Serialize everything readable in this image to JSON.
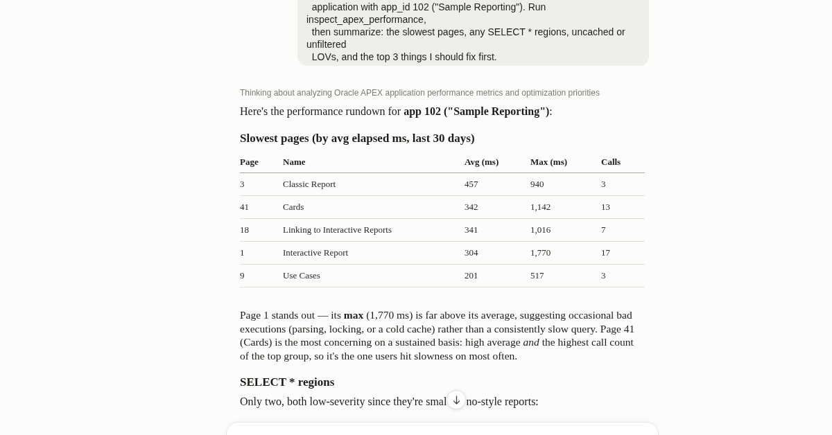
{
  "user_message": {
    "lines": [
      "  application with app_id 102 (\"Sample Reporting\"). Run",
      "inspect_apex_performance,",
      "  then summarize: the slowest pages, any SELECT * regions, uncached or",
      "unfiltered",
      "  LOVs, and the top 3 things I should fix first."
    ]
  },
  "thinking": {
    "label": "Thinking about analyzing Oracle APEX application performance metrics and optimization priorities"
  },
  "response": {
    "intro": "Here's the performance rundown for **app 102 (\"Sample Reporting\")**:",
    "slowest_pages": {
      "heading": "Slowest pages (by avg elapsed ms, last 30 days)",
      "table": {
        "columns": [
          "Page",
          "Name",
          "Avg (ms)",
          "Max (ms)",
          "Calls"
        ],
        "rows": [
          [
            "3",
            "Classic Report",
            "457",
            "940",
            "3"
          ],
          [
            "41",
            "Cards",
            "342",
            "1,142",
            "13"
          ],
          [
            "18",
            "Linking to Interactive Reports",
            "341",
            "1,016",
            "7"
          ],
          [
            "1",
            "Interactive Report",
            "304",
            "1,770",
            "17"
          ],
          [
            "9",
            "Use Cases",
            "201",
            "517",
            "3"
          ]
        ]
      }
    },
    "analysis": "Page 1 stands out — its **max** (1,770 ms) is far above its average, suggesting occasional bad executions (parsing, locking, or a cold cache) rather than a consistently slow query. Page 41 (Cards) is the most concerning on a sustained basis: high average *and* the highest call count of the top group, so it's the one users hit slowness on most often.",
    "select_regions": {
      "heading": "SELECT * regions",
      "intro_parts": [
        "Only two, both low-severity since they're smal",
        "no-style reports:"
      ]
    }
  }
}
